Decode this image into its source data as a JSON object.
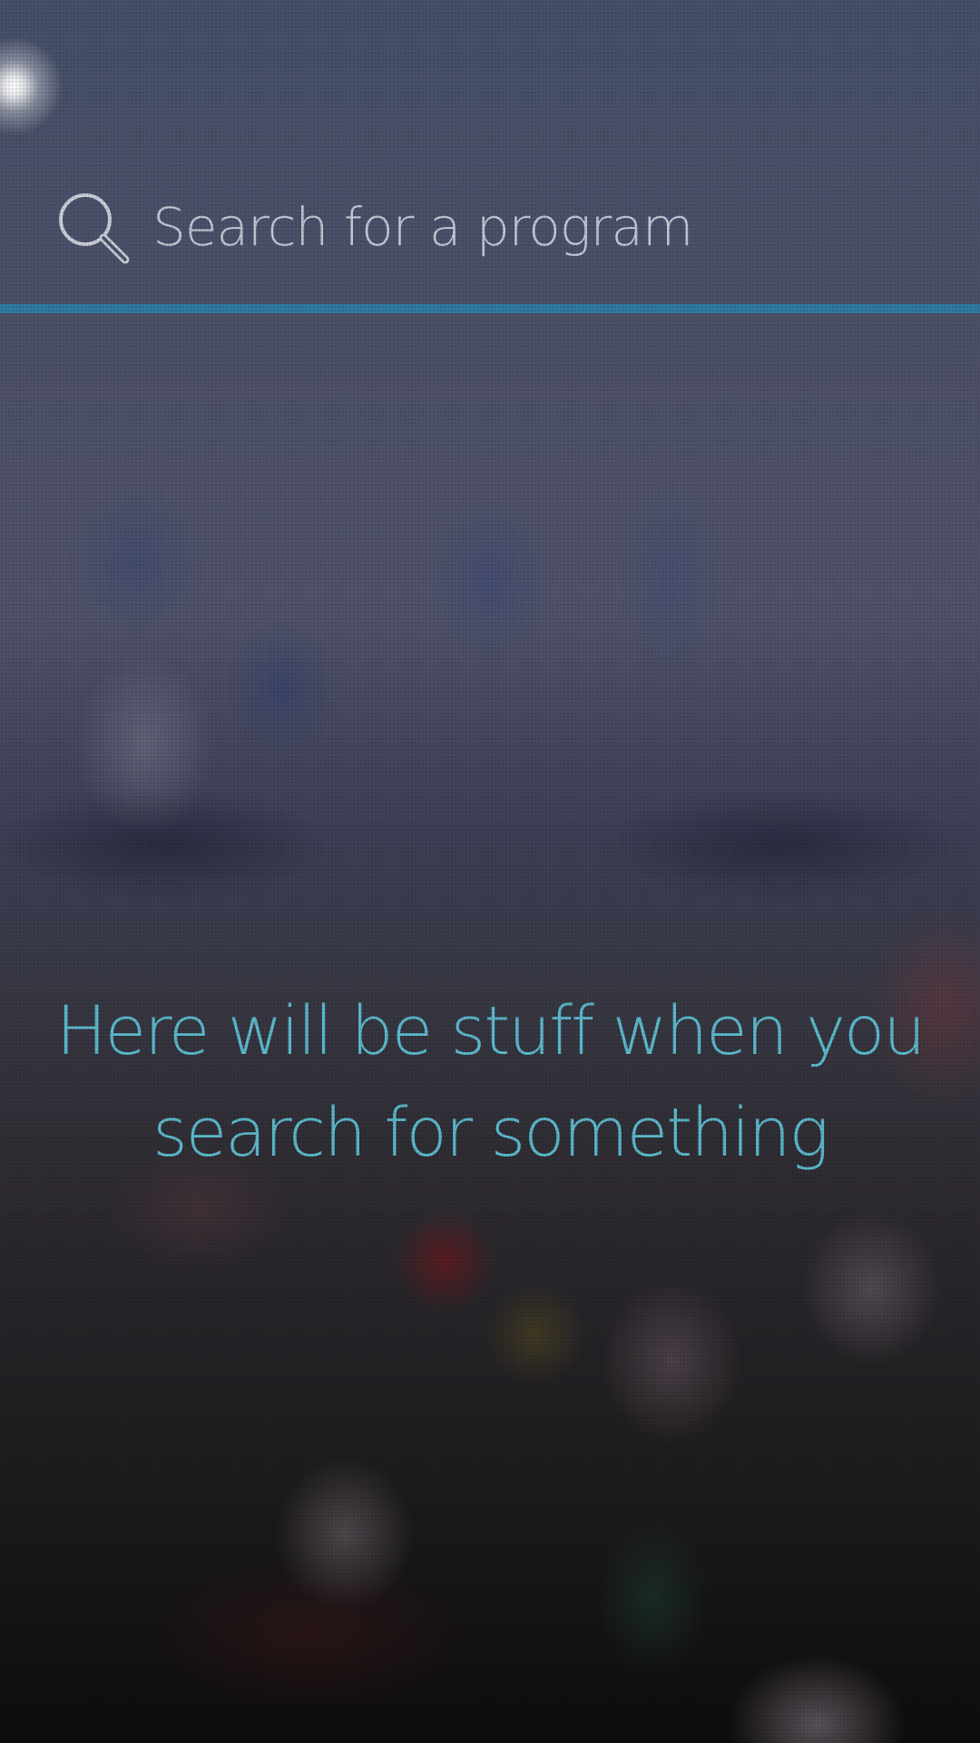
{
  "search": {
    "placeholder": "Search for a program",
    "value": "",
    "icon": "search-icon",
    "accent_color": "#2f7aa0"
  },
  "results": {
    "empty_message": "Here will be stuff when you search for something",
    "text_color": "#5bb8cb"
  }
}
